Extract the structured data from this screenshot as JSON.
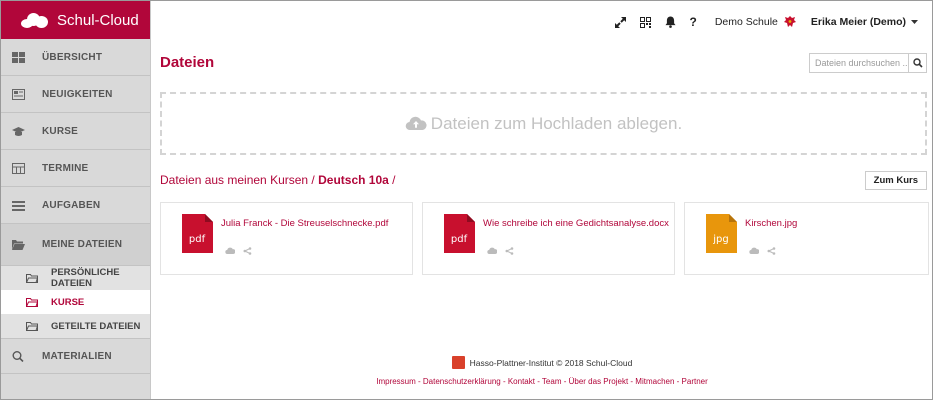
{
  "colors": {
    "brand": "#b1063a",
    "sidebar_bg": "#d9d9d9",
    "pdf": "#c8102e",
    "jpg": "#e8960c"
  },
  "brand": {
    "name": "Schul-Cloud"
  },
  "sidebar": {
    "items": [
      {
        "label": "ÜBERSICHT",
        "icon": "dashboard-icon"
      },
      {
        "label": "NEUIGKEITEN",
        "icon": "newspaper-icon"
      },
      {
        "label": "KURSE",
        "icon": "graduation-cap-icon"
      },
      {
        "label": "TERMINE",
        "icon": "calendar-icon"
      },
      {
        "label": "AUFGABEN",
        "icon": "tasks-icon"
      },
      {
        "label": "MEINE DATEIEN",
        "icon": "folder-open-icon"
      },
      {
        "label": "MATERIALIEN",
        "icon": "search-icon"
      }
    ],
    "sub_items": [
      {
        "label": "PERSÖNLICHE DATEIEN",
        "icon": "folder-icon"
      },
      {
        "label": "KURSE",
        "icon": "folder-icon"
      },
      {
        "label": "GETEILTE DATEIEN",
        "icon": "folder-icon"
      }
    ]
  },
  "topbar": {
    "school": "Demo Schule",
    "user": "Erika Meier (Demo)"
  },
  "main": {
    "title": "Dateien",
    "search_placeholder": "Dateien durchsuchen ...",
    "dropzone_text": "Dateien zum Hochladen ablegen.",
    "breadcrumb_prefix": "Dateien aus meinen Kursen /",
    "breadcrumb_current": "Deutsch 10a",
    "breadcrumb_suffix": "/",
    "zum_kurs": "Zum Kurs"
  },
  "files": [
    {
      "name": "Julia Franck - Die Streuselschnecke.pdf",
      "type": "pdf"
    },
    {
      "name": "Wie schreibe ich eine Gedichtsanalyse.docx",
      "type": "pdf"
    },
    {
      "name": "Kirschen.jpg",
      "type": "jpg"
    }
  ],
  "footer": {
    "line1": "Hasso-Plattner-Institut  © 2018 Schul-Cloud",
    "links": "Impressum - Datenschutzerklärung - Kontakt - Team - Über das Projekt - Mitmachen - Partner"
  }
}
